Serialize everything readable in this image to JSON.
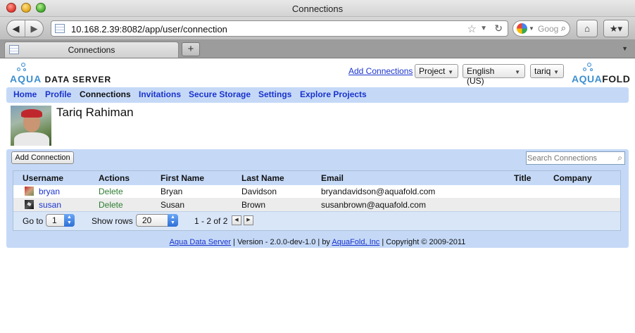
{
  "window": {
    "title": "Connections"
  },
  "browser": {
    "url": "10.168.2.39:8082/app/user/connection",
    "search_placeholder": "Goog",
    "tab_label": "Connections",
    "new_tab_label": "+"
  },
  "header": {
    "logo_left_prefix": "AQUA",
    "logo_left_suffix": "DATA SERVER",
    "logo_right_prefix": "AQUA",
    "logo_right_suffix": "FOLD",
    "add_connections_link": "Add Connections",
    "project_select": "Project",
    "language_select": "English (US)",
    "user_select": "tariq"
  },
  "nav": {
    "items": [
      {
        "label": "Home"
      },
      {
        "label": "Profile"
      },
      {
        "label": "Connections",
        "active": true
      },
      {
        "label": "Invitations"
      },
      {
        "label": "Secure Storage"
      },
      {
        "label": "Settings"
      },
      {
        "label": "Explore Projects"
      }
    ]
  },
  "profile": {
    "name": "Tariq Rahiman"
  },
  "connections": {
    "add_button": "Add Connection",
    "search_placeholder": "Search Connections",
    "columns": [
      "Username",
      "Actions",
      "First Name",
      "Last Name",
      "Email",
      "Title",
      "Company"
    ],
    "rows": [
      {
        "username": "bryan",
        "action": "Delete",
        "first": "Bryan",
        "last": "Davidson",
        "email": "bryandavidson@aquafold.com",
        "title": "",
        "company": ""
      },
      {
        "username": "susan",
        "action": "Delete",
        "first": "Susan",
        "last": "Brown",
        "email": "susanbrown@aquafold.com",
        "title": "",
        "company": ""
      }
    ],
    "pager": {
      "goto_label": "Go to",
      "goto_value": "1",
      "rows_label": "Show rows",
      "rows_value": "20",
      "range": "1 - 2 of 2"
    }
  },
  "footer": {
    "product_link": "Aqua Data Server",
    "version": " | Version - 2.0.0-dev-1.0 | by ",
    "company_link": "AquaFold, Inc",
    "copyright": " | Copyright © 2009-2011"
  },
  "colors": {
    "accent_blue": "#c5d9f7",
    "link_blue": "#1a33cc",
    "action_green": "#2e7d32"
  }
}
